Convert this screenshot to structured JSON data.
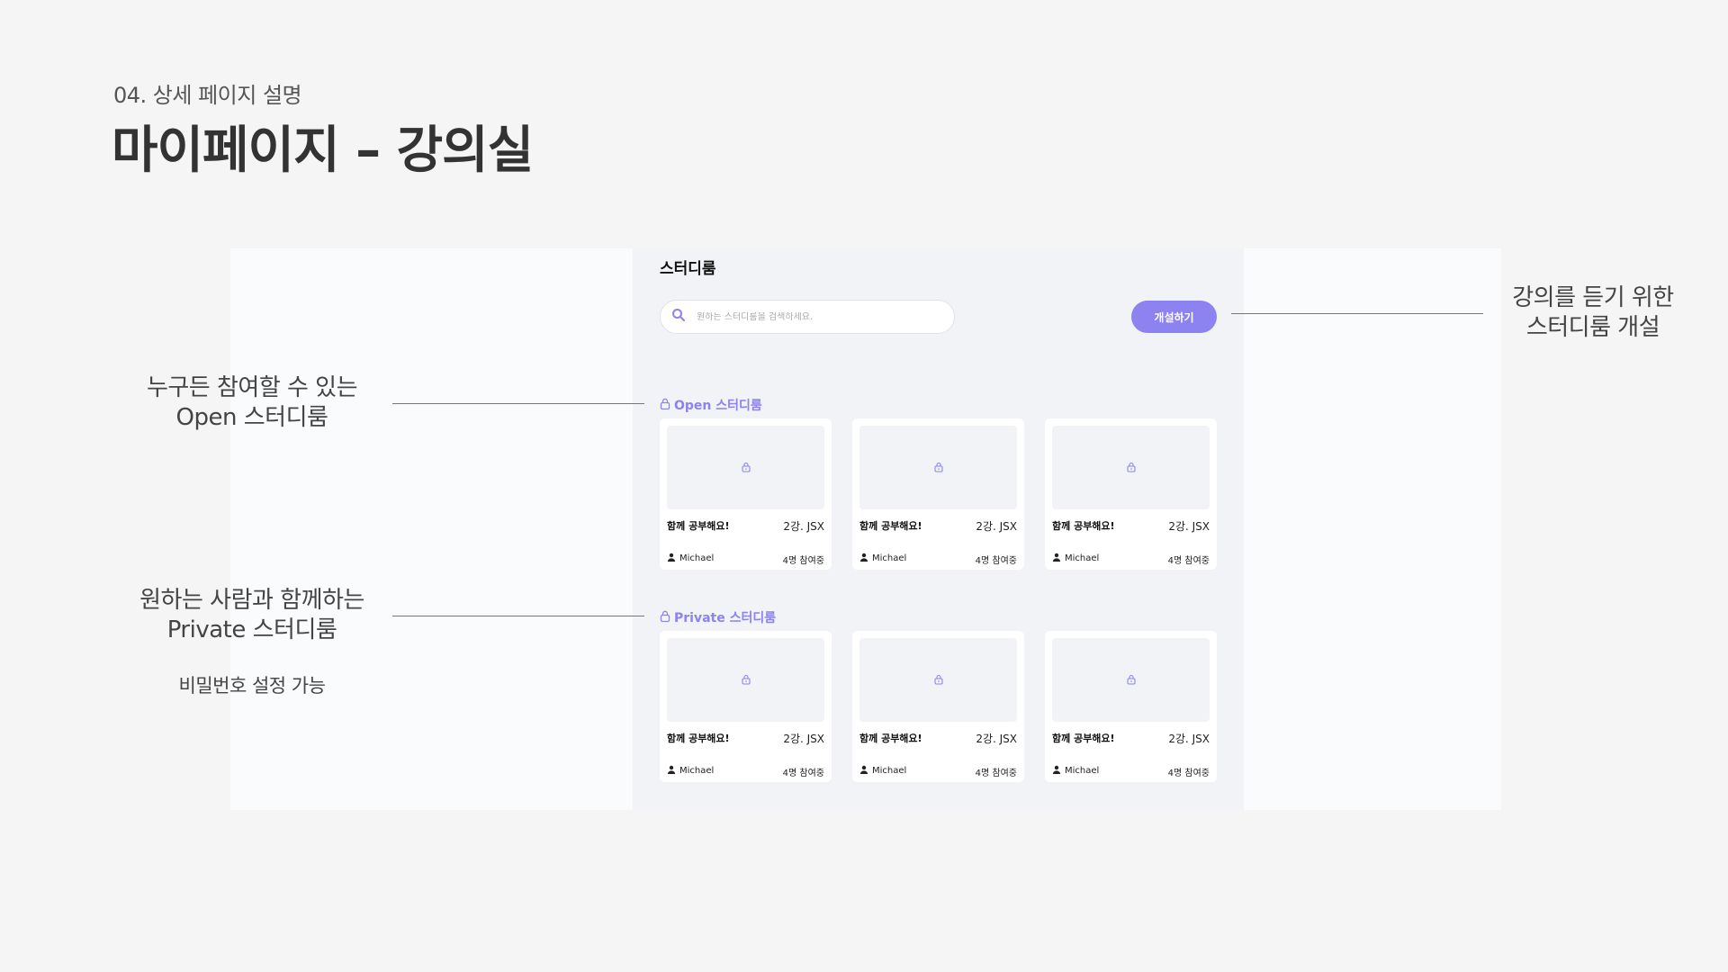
{
  "header": {
    "subtitle": "04. 상세 페이지 설명",
    "title": "마이페이지 – 강의실"
  },
  "app": {
    "title": "스터디룸",
    "search": {
      "placeholder": "원하는 스터디룸을 검색하세요.",
      "icon": "search-icon"
    },
    "create_button": "개설하기",
    "accent_color": "#8c82f0",
    "sections": [
      {
        "label": "Open 스터디룸",
        "icon": "lock-icon",
        "cards": [
          {
            "title": "함께 공부해요!",
            "lesson": "2강. JSX",
            "author": "Michael",
            "participants": "4명 참여중"
          },
          {
            "title": "함께 공부해요!",
            "lesson": "2강. JSX",
            "author": "Michael",
            "participants": "4명 참여중"
          },
          {
            "title": "함께 공부해요!",
            "lesson": "2강. JSX",
            "author": "Michael",
            "participants": "4명 참여중"
          }
        ]
      },
      {
        "label": "Private 스터디룸",
        "icon": "lock-icon",
        "cards": [
          {
            "title": "함께 공부해요!",
            "lesson": "2강. JSX",
            "author": "Michael",
            "participants": "4명 참여중"
          },
          {
            "title": "함께 공부해요!",
            "lesson": "2강. JSX",
            "author": "Michael",
            "participants": "4명 참여중"
          },
          {
            "title": "함께 공부해요!",
            "lesson": "2강. JSX",
            "author": "Michael",
            "participants": "4명 참여중"
          }
        ]
      }
    ]
  },
  "annotations": {
    "open": {
      "line1": "누구든 참여할 수 있는",
      "line2": "Open 스터디룸"
    },
    "private": {
      "line1": "원하는 사람과 함께하는",
      "line2": "Private 스터디룸",
      "note": "비밀번호 설정 가능"
    },
    "create": {
      "line1": "강의를 듣기 위한",
      "line2": "스터디룸 개설"
    }
  }
}
